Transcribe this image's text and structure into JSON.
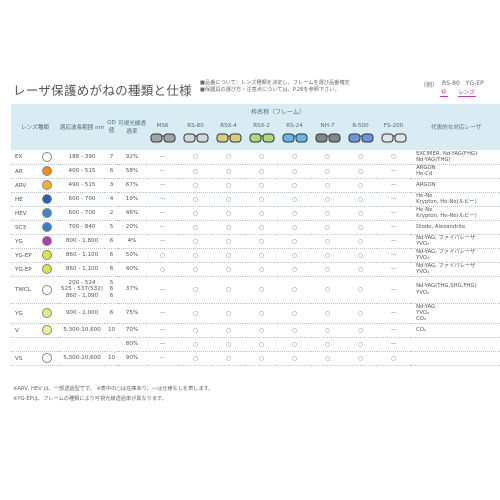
{
  "title": "レーザ保護めがねの種類と仕様",
  "notes": [
    "■品番について：レンズ種類を決定し、フレームを選び品番確定",
    "■保護具の選び方・注意点については、P.28を参照下さい。"
  ],
  "example": {
    "prefix": "（例）",
    "frame_value": "RS-80",
    "lens_value": "YG-EP",
    "frame_label": "枠",
    "lens_label": "レンズ"
  },
  "headers": {
    "lens_type": "レンズ種類",
    "wavelength": "適応波長範囲 nm",
    "od": "OD値",
    "transmittance": "可視光線透過率",
    "frame_group": "枠名称（フレーム）",
    "laser": "代表的な対応レーザ"
  },
  "frames": [
    "MS6",
    "RS-80",
    "RSX-4",
    "RSX-2",
    "RS-24",
    "NH-7",
    "R-500",
    "FS-200"
  ],
  "colors": {
    "header_bg": "#d9ecf3",
    "accent_pink": "#c040a0"
  },
  "rows": [
    {
      "lens": "EX",
      "color": "#ffffff",
      "wl": "188 - 390",
      "od": "7",
      "vlt": "92%",
      "f": [
        "—",
        "○",
        "○",
        "○",
        "○",
        "○",
        "○",
        "○"
      ],
      "laser": "EXCIMER, Nd-YAG(FHG)\nNd-YAG(THG)"
    },
    {
      "lens": "AR",
      "color": "#f08a1c",
      "wl": "400 - 515",
      "od": "6",
      "vlt": "58%",
      "f": [
        "—",
        "○",
        "○",
        "○",
        "○",
        "○",
        "○",
        "—"
      ],
      "laser": "ARGON\nHe-Cd"
    },
    {
      "lens": "ARV",
      "color": "#f2b134",
      "wl": "490 - 515",
      "od": "3",
      "vlt": "67%",
      "f": [
        "—",
        "○",
        "○",
        "○",
        "○",
        "○",
        "○",
        "—"
      ],
      "laser": "ARGON"
    },
    {
      "lens": "HE",
      "color": "#2b5fb0",
      "wl": "600 - 700",
      "od": "4",
      "vlt": "19%",
      "f": [
        "—",
        "○",
        "○",
        "○",
        "○",
        "○",
        "○",
        "—"
      ],
      "laser": "He-Ne\nKrypton, He-Ne(ルビー)"
    },
    {
      "lens": "HEV",
      "color": "#3f86c8",
      "wl": "600 - 700",
      "od": "2",
      "vlt": "46%",
      "f": [
        "—",
        "○",
        "○",
        "○",
        "○",
        "○",
        "○",
        "—"
      ],
      "laser": "He-Ne\nKrypton, He-Ne(ルビー)"
    },
    {
      "lens": "SC3",
      "color": "#3a7fc0",
      "wl": "700 - 840",
      "od": "5",
      "vlt": "20%",
      "f": [
        "—",
        "○",
        "○",
        "○",
        "○",
        "○",
        "○",
        "—"
      ],
      "laser": "Diode, Alexandrite"
    },
    {
      "lens": "YG",
      "color": "#b040a8",
      "wl": "800 - 1,800",
      "od": "6",
      "vlt": "4%",
      "f": [
        "—",
        "○",
        "○",
        "○",
        "○",
        "○",
        "○",
        "—"
      ],
      "laser": "Nd-YAG, ファイバレーザ\nYVO₄"
    },
    {
      "lens": "YG-EP",
      "color": "#d8e44a",
      "wl": "860 - 1,100",
      "od": "6",
      "vlt": "50%",
      "f": [
        "○",
        "○",
        "○",
        "○",
        "○",
        "○",
        "○",
        "—"
      ],
      "laser": "Nd-YAG, ファイバレーザ\nYVO₄"
    },
    {
      "lens": "YG-EP",
      "color": "#d8e44a",
      "wl": "860 - 1,100",
      "od": "6",
      "vlt": "40%",
      "f": [
        "○",
        "○",
        "○",
        "○",
        "○",
        "○",
        "○",
        "—"
      ],
      "laser": "Nd-YAG, ファイバレーザ\nYVO₄"
    },
    {
      "lens": "TWCL",
      "color": "#ffffff",
      "wl": "200 - 524\n525 - 537(532)\n860 - 1,090",
      "od": "5\n6\n6",
      "vlt": "37%",
      "f": [
        "—",
        "○",
        "○",
        "○",
        "○",
        "○",
        "○",
        "—"
      ],
      "laser": "Nd-YAG(THG,SHG,FHG)\nYVO₄"
    },
    {
      "lens": "YG",
      "color": "#e6e98a",
      "wl": "900 - 2,000",
      "od": "6",
      "vlt": "75%",
      "f": [
        "—",
        "○",
        "○",
        "○",
        "○",
        "○",
        "○",
        "—"
      ],
      "laser": "Nd-YAG\nYVO₄\nCO₂"
    },
    {
      "lens": "V",
      "color": "#f4f099",
      "wl": "5,300-10,600",
      "od": "10",
      "vlt": "70%",
      "f": [
        "—",
        "○",
        "○",
        "○",
        "○",
        "○",
        "○",
        "—"
      ],
      "laser": "CO₂"
    },
    {
      "lens": "",
      "color": "",
      "wl": "",
      "od": "",
      "vlt": "80%",
      "f": [
        "—",
        "○",
        "○",
        "○",
        "○",
        "○",
        "○",
        "—"
      ],
      "laser": ""
    },
    {
      "lens": "VS",
      "color": "#ffffff",
      "wl": "5,300-10,600",
      "od": "10",
      "vlt": "90%",
      "f": [
        "—",
        "○",
        "○",
        "○",
        "○",
        "○",
        "○",
        "○"
      ],
      "laser": ""
    }
  ],
  "footnotes": [
    "※ARV, HEV は、一部透過型です。  ※表中の○は在庫あり、—は仕様なしを表します。",
    "※YG-EPは、フレームの種類により可視光線透過率が異なります。"
  ]
}
